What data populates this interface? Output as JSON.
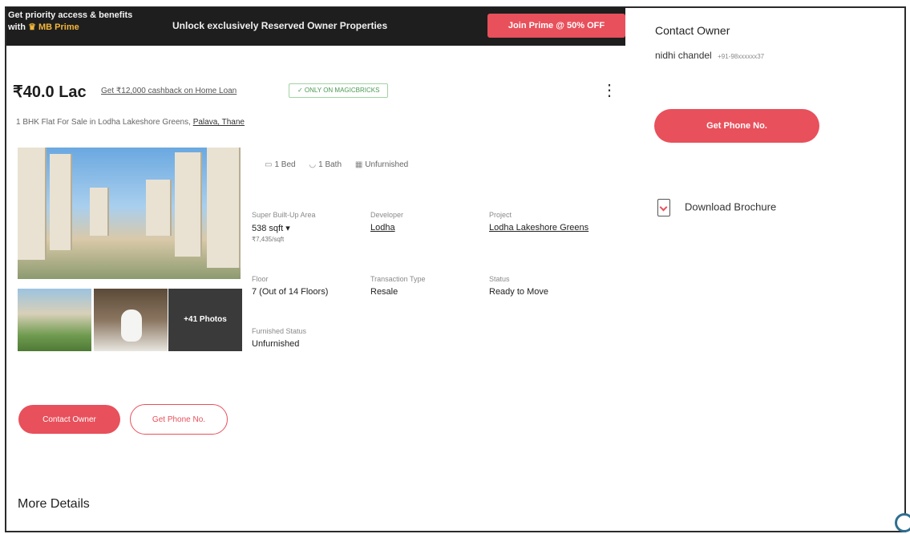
{
  "banner": {
    "lead_line1": "Get priority access & benefits",
    "lead_line2_prefix": "with",
    "lead_line2_brand": "MB Prime",
    "headline": "Unlock exclusively Reserved Owner Properties",
    "cta": "Join Prime @ 50% OFF",
    "crown_icon": "crown-icon"
  },
  "listing": {
    "price": "₹40.0 Lac",
    "cashback_link": "Get ₹12,000 cashback on Home Loan",
    "badge": "✓ ONLY ON MAGICBRICKS",
    "title_prefix": "1 BHK Flat For Sale in Lodha Lakeshore Greens,",
    "location": "Palava, Thane",
    "more_photos": "+41 Photos",
    "quick_facts": [
      {
        "icon": "bed-icon",
        "glyph": "🛏",
        "label": "1 Bed"
      },
      {
        "icon": "bath-icon",
        "glyph": "🛁",
        "label": "1 Bath"
      },
      {
        "icon": "furnishing-icon",
        "glyph": "▦",
        "label": "Unfurnished"
      }
    ],
    "details": {
      "area_label": "Super Built-Up Area",
      "area_value": "538 sqft",
      "area_rate": "₹7,435/sqft",
      "developer_label": "Developer",
      "developer_value": "Lodha",
      "project_label": "Project",
      "project_value": "Lodha Lakeshore Greens",
      "floor_label": "Floor",
      "floor_value": "7 (Out of 14 Floors)",
      "transaction_label": "Transaction Type",
      "transaction_value": "Resale",
      "status_label": "Status",
      "status_value": "Ready to Move",
      "furnished_label": "Furnished Status",
      "furnished_value": "Unfurnished"
    },
    "buttons": {
      "contact": "Contact Owner",
      "phone": "Get Phone No."
    },
    "more_details": "More Details"
  },
  "sidebar": {
    "title": "Contact Owner",
    "owner_name": "nidhi chandel",
    "owner_phone": "+91-98xxxxxx37",
    "phone_button": "Get Phone No.",
    "brochure": "Download Brochure"
  },
  "colors": {
    "accent": "#e8505b",
    "banner_bg": "#1e1e1e",
    "prime_gold": "#f3b63a",
    "badge_green": "#4a9a52"
  }
}
